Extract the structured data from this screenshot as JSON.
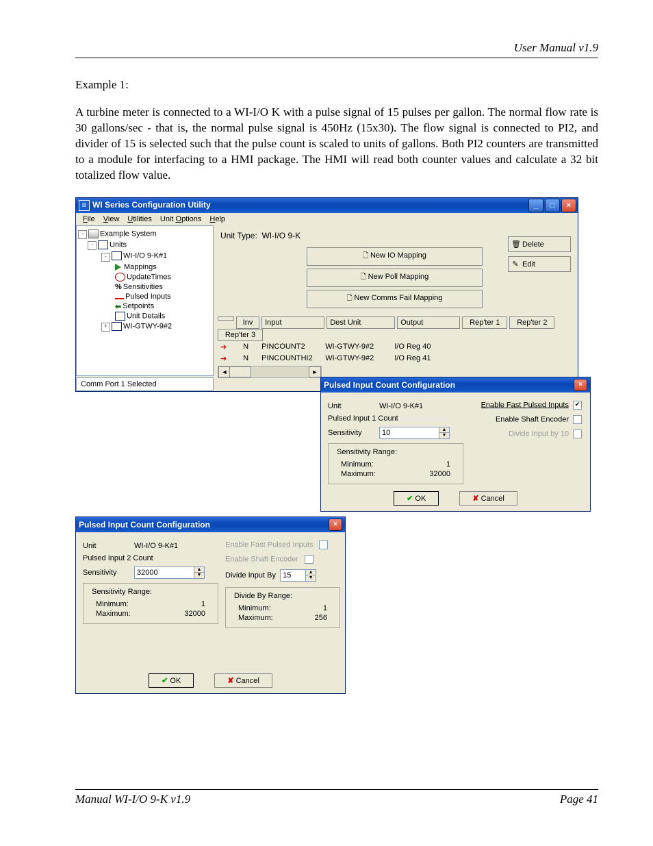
{
  "doc": {
    "header_right": "User Manual v1.9",
    "example_heading": "Example 1:",
    "paragraph": "A turbine meter is connected to a WI-I/O K with a pulse signal of 15 pulses per gallon.  The normal flow rate is 30 gallons/sec  -  that is,  the normal pulse signal is 450Hz (15x30). The flow signal is connected to PI2,  and divider of 15 is selected such that the pulse count is scaled to units of gallons.  Both PI2 counters are transmitted to a module for interfacing to a HMI package.  The HMI will read both counter values and calculate a 32 bit totalized flow value.",
    "footer_left": "Manual WI-I/O 9-K v1.9",
    "footer_right": "Page 41"
  },
  "app": {
    "title": "WI Series Configuration Utility",
    "menubar": [
      "File",
      "View",
      "Utilities",
      "Unit Options",
      "Help"
    ],
    "tree": {
      "root": "Example System",
      "units_label": "Units",
      "node1": "WI-I/O 9-K#1",
      "children": [
        "Mappings",
        "UpdateTimes",
        "Sensitivities",
        "Pulsed Inputs",
        "Setpoints",
        "Unit Details"
      ],
      "node2": "WI-GTWY-9#2"
    },
    "status": "Comm Port 1 Selected",
    "unit_type_label": "Unit Type:",
    "unit_type_value": "WI-I/O 9-K",
    "map_buttons": [
      "New IO Mapping",
      "New Poll Mapping",
      "New Comms Fail Mapping"
    ],
    "side_buttons": {
      "delete": "Delete",
      "edit": "Edit"
    },
    "table": {
      "headers": [
        "Inv",
        "Input",
        "Dest Unit",
        "Output",
        "Rep'ter 1",
        "Rep'ter 2",
        "Rep'ter 3"
      ],
      "rows": [
        {
          "inv": "N",
          "input": "PINCOUNT2",
          "dest": "WI-GTWY-9#2",
          "output": "I/O Reg 40"
        },
        {
          "inv": "N",
          "input": "PINCOUNTHI2",
          "dest": "WI-GTWY-9#2",
          "output": "I/O Reg 41"
        }
      ]
    }
  },
  "dlg1": {
    "title": "Pulsed Input Count Configuration",
    "unit_label": "Unit",
    "unit_value": "WI-I/O 9-K#1",
    "input_label": "Pulsed Input 1 Count",
    "sens_label": "Sensitivity",
    "sens_value": "10",
    "range_title": "Sensitivity Range:",
    "min_label": "Minimum:",
    "min_value": "1",
    "max_label": "Maximum:",
    "max_value": "32000",
    "cb1": "Enable Fast Pulsed Inputs",
    "cb2": "Enable Shaft Encoder",
    "cb3": "Divide Input by 10",
    "ok": "OK",
    "cancel": "Cancel"
  },
  "dlg2": {
    "title": "Pulsed Input Count Configuration",
    "unit_label": "Unit",
    "unit_value": "WI-I/O 9-K#1",
    "input_label": "Pulsed Input 2 Count",
    "sens_label": "Sensitivity",
    "sens_value": "32000",
    "range_title": "Sensitivity Range:",
    "min_label": "Minimum:",
    "min_value": "1",
    "max_label": "Maximum:",
    "max_value": "32000",
    "cb1": "Enable Fast Pulsed Inputs",
    "cb2": "Enable Shaft Encoder",
    "div_label": "Divide Input By",
    "div_value": "15",
    "div_range_title": "Divide By Range:",
    "div_min_label": "Minimum:",
    "div_min_value": "1",
    "div_max_label": "Maximum:",
    "div_max_value": "256",
    "ok": "OK",
    "cancel": "Cancel"
  }
}
